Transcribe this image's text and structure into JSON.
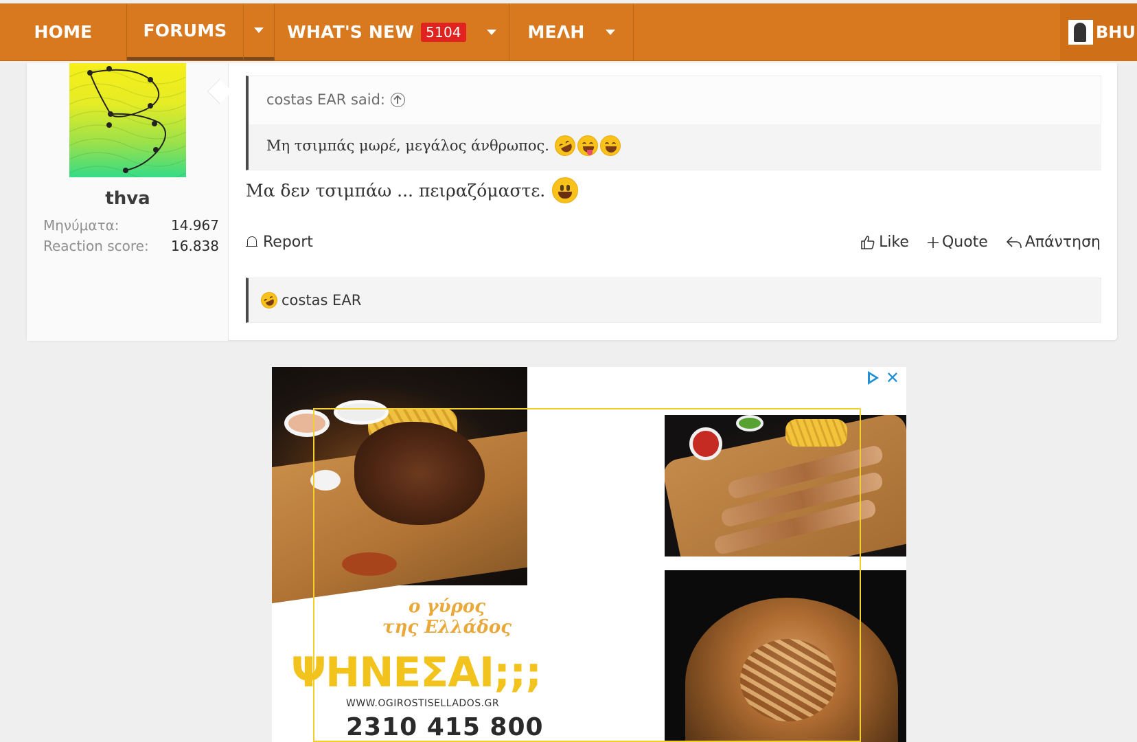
{
  "nav": {
    "home": "HOME",
    "forums": "FORUMS",
    "whats_new": "WHAT'S NEW",
    "whats_new_badge": "5104",
    "members": "ΜΕΛΗ",
    "user_name": "BHU"
  },
  "post": {
    "username": "thva",
    "stats": [
      {
        "label": "Μηνύματα:",
        "value": "14.967"
      },
      {
        "label": "Reaction score:",
        "value": "16.838"
      }
    ],
    "quote": {
      "author_line": "costas EAR said:",
      "text": "Μη τσιμπάς μωρέ, μεγάλος άνθρωπος."
    },
    "message": "Μα δεν τσιμπάω ... πειραζόμαστε.",
    "actions": {
      "report": "Report",
      "like": "Like",
      "quote": "Quote",
      "reply": "Απάντηση"
    },
    "reactions": {
      "user": "costas EAR"
    }
  },
  "ad": {
    "brand_line1": "ο γύρος",
    "brand_line2": "της Ελλάδος",
    "headline": "ΨΗΝΕΣΑΙ;;;",
    "url": "WWW.OGIROSTISELLADOS.GR",
    "phone": "2310 415 800"
  }
}
